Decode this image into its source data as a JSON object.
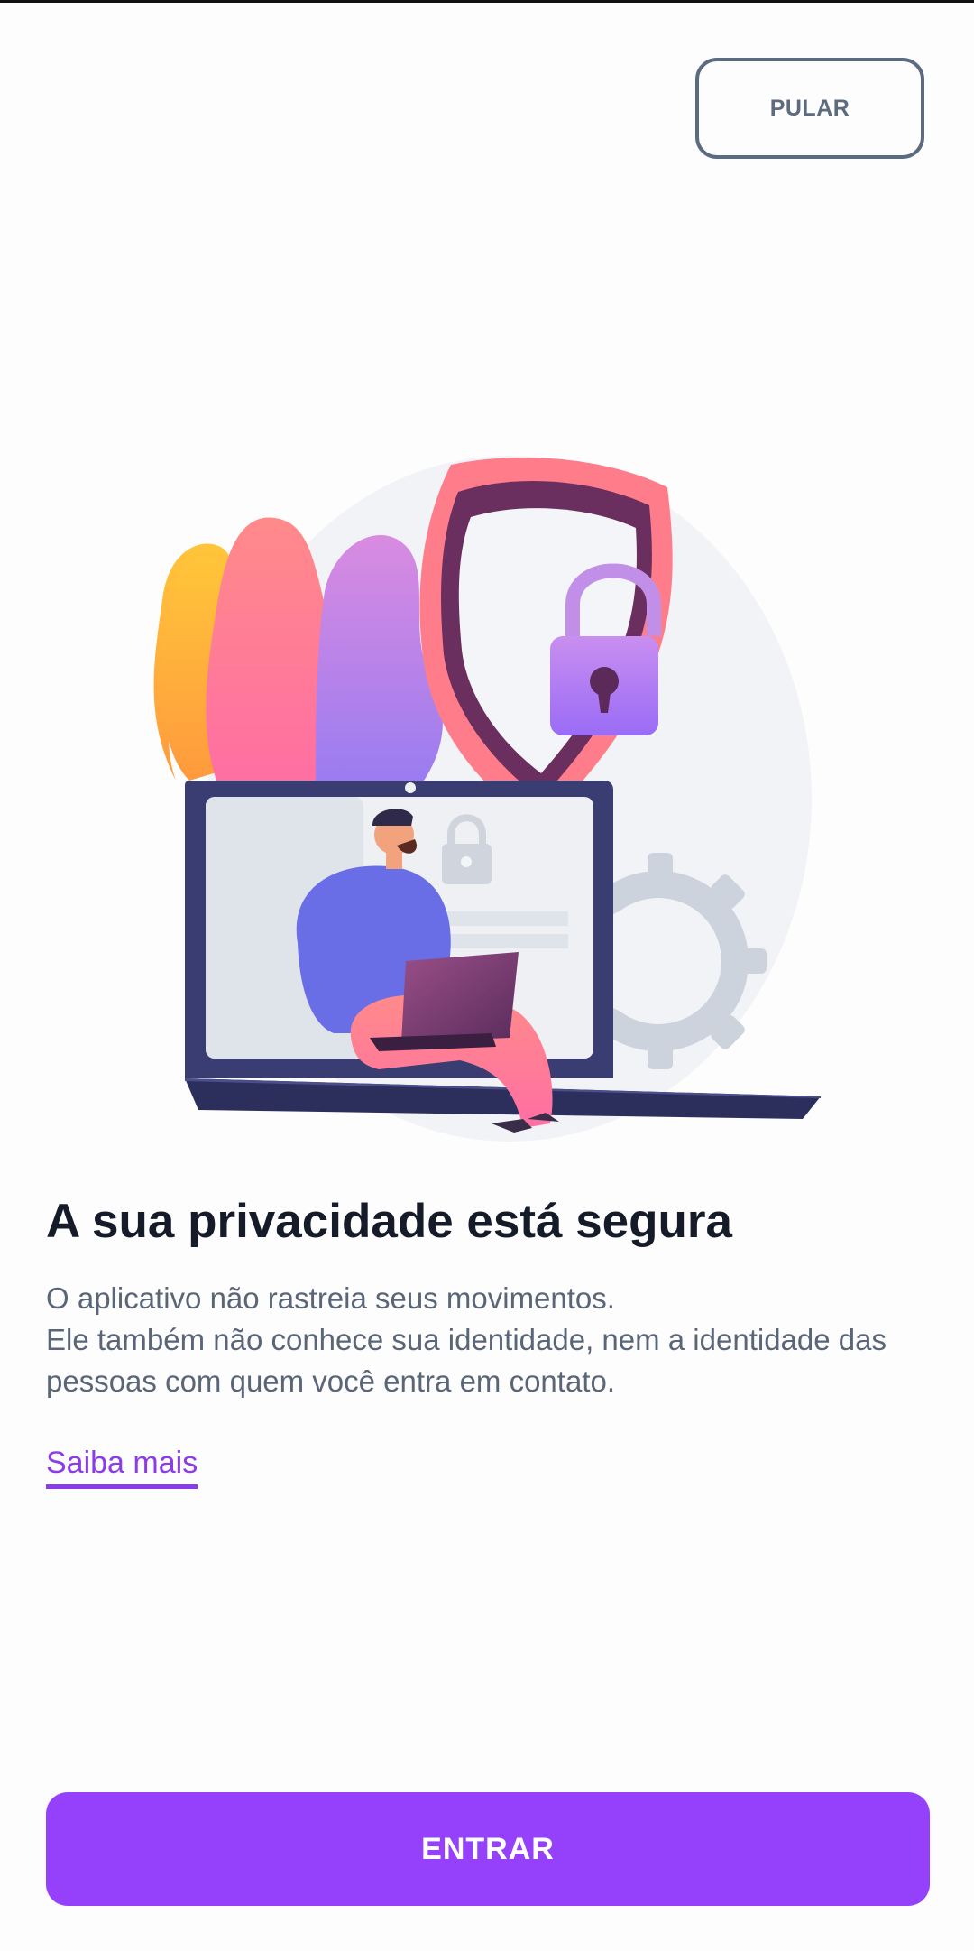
{
  "header": {
    "skip_label": "PULAR"
  },
  "illustration": {
    "name": "privacy-illustration"
  },
  "content": {
    "title": "A sua privacidade está segura",
    "description_lines": [
      "O aplicativo não rastreia seus movimentos.",
      "Ele também não conhece sua identidade, nem a identidade das pessoas com quem você entra em contato."
    ],
    "learn_more_label": "Saiba mais"
  },
  "footer": {
    "enter_label": "ENTRAR"
  },
  "colors": {
    "accent": "#9540fb",
    "link": "#8b3ce8",
    "text_primary": "#151b28",
    "text_secondary": "#5a6678",
    "outline": "#5d6b80"
  }
}
